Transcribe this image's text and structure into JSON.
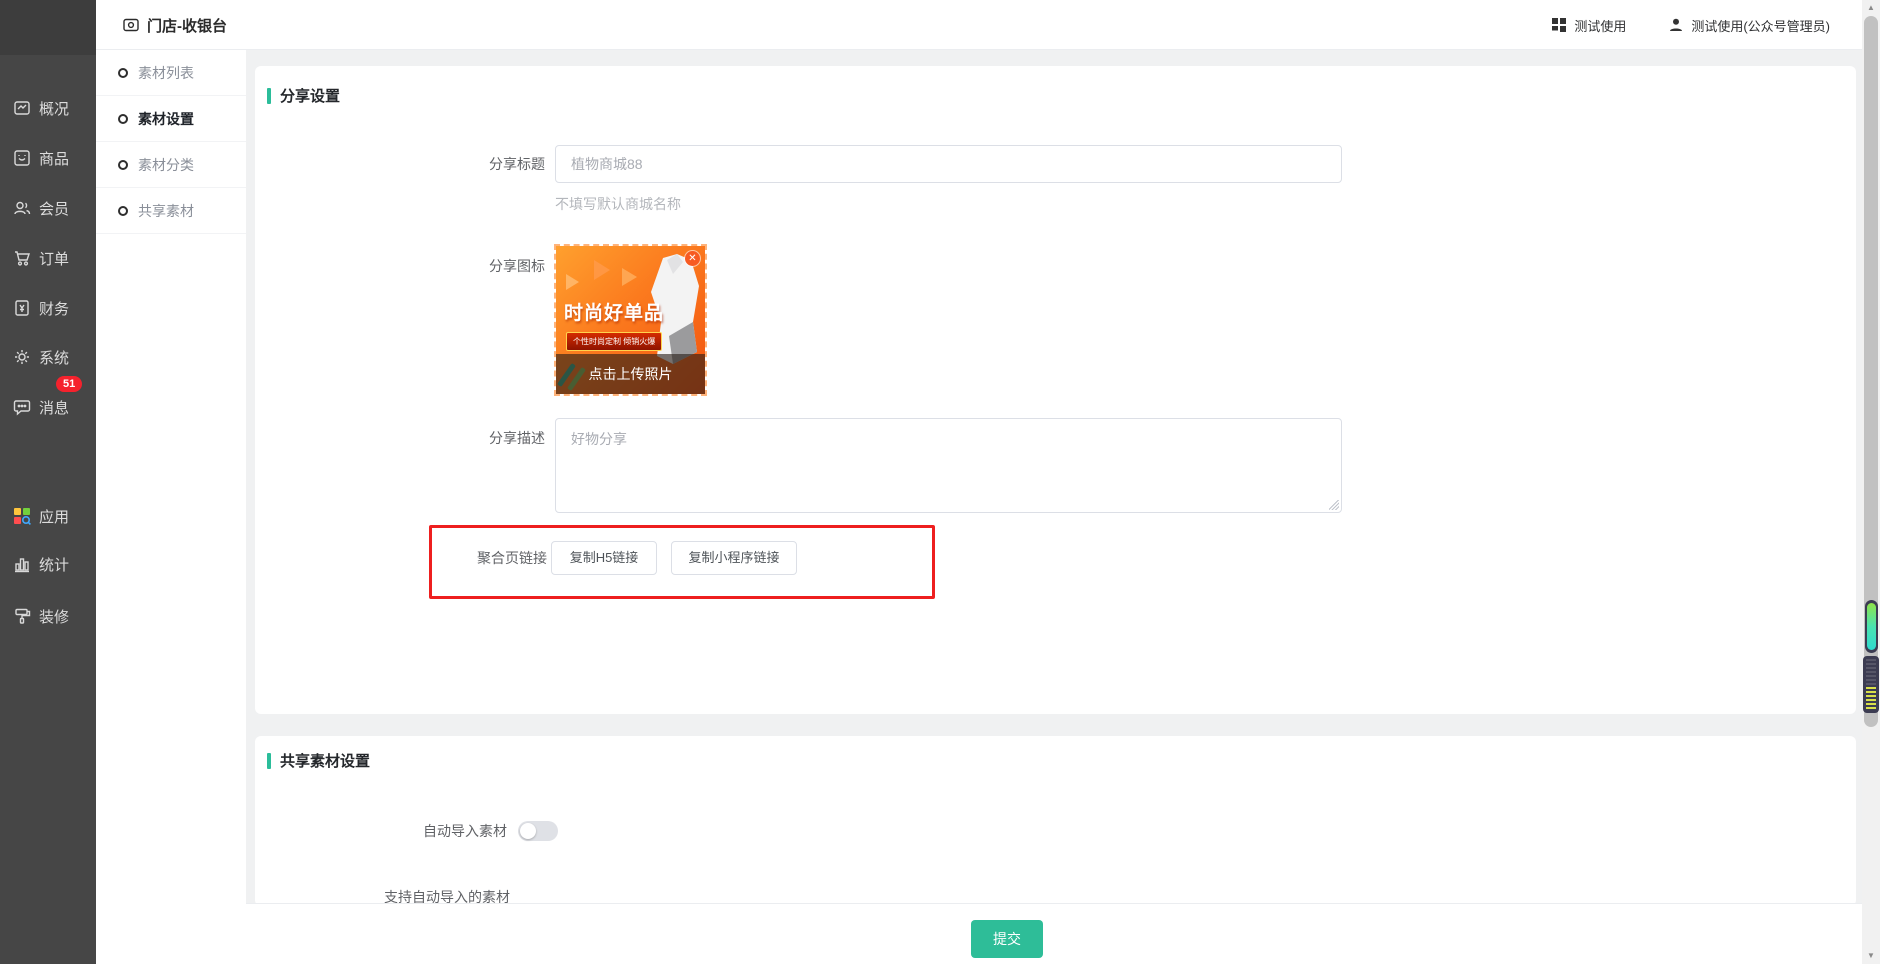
{
  "header": {
    "title": "门店-收银台",
    "workspace_label": "测试使用",
    "user_label": "测试使用(公众号管理员)"
  },
  "sidebar": {
    "items": [
      {
        "icon": "overview-icon",
        "label": "概况"
      },
      {
        "icon": "goods-icon",
        "label": "商品"
      },
      {
        "icon": "members-icon",
        "label": "会员"
      },
      {
        "icon": "orders-icon",
        "label": "订单"
      },
      {
        "icon": "finance-icon",
        "label": "财务"
      },
      {
        "icon": "system-icon",
        "label": "系统"
      },
      {
        "icon": "messages-icon",
        "label": "消息",
        "badge": "51"
      },
      {
        "icon": "apps-icon",
        "label": "应用"
      },
      {
        "icon": "stats-icon",
        "label": "统计"
      },
      {
        "icon": "decorate-icon",
        "label": "装修"
      }
    ]
  },
  "submenu": {
    "items": [
      {
        "label": "素材列表",
        "active": false
      },
      {
        "label": "素材设置",
        "active": true
      },
      {
        "label": "素材分类",
        "active": false
      },
      {
        "label": "共享素材",
        "active": false
      }
    ]
  },
  "card_share": {
    "section_title": "分享设置",
    "title_label": "分享标题",
    "title_value": "植物商城88",
    "title_hint": "不填写默认商城名称",
    "icon_label": "分享图标",
    "image_headline": "时尚好单品",
    "image_subline": "个性时尚定制 倾销火爆",
    "upload_text": "点击上传照片",
    "close_glyph": "✕",
    "desc_label": "分享描述",
    "desc_value": "好物分享",
    "link_label": "聚合页链接",
    "copy_h5": "复制H5链接",
    "copy_mini": "复制小程序链接"
  },
  "card_shared": {
    "section_title": "共享素材设置",
    "auto_label": "自动导入素材",
    "support_label": "支持自动导入的素材"
  },
  "footer": {
    "submit_label": "提交"
  },
  "scrollbar": {
    "up_glyph": "▲",
    "down_glyph": "▼"
  },
  "colors": {
    "accent": "#2bbd9a",
    "badge": "#f5222d",
    "highlight_box": "#ee1f1f",
    "submit": "#2ebd98"
  }
}
